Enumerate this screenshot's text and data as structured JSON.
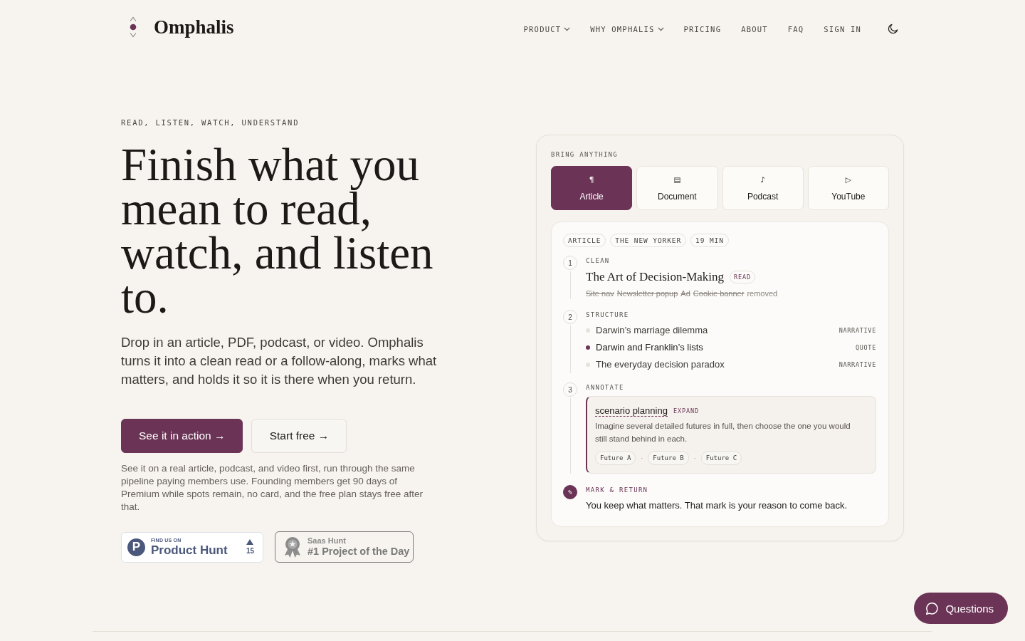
{
  "header": {
    "logo": "Omphalis",
    "nav": [
      {
        "label": "PRODUCT",
        "dropdown": true
      },
      {
        "label": "WHY OMPHALIS",
        "dropdown": true
      },
      {
        "label": "PRICING",
        "dropdown": false
      },
      {
        "label": "ABOUT",
        "dropdown": false
      },
      {
        "label": "FAQ",
        "dropdown": false
      },
      {
        "label": "SIGN IN",
        "dropdown": false
      }
    ]
  },
  "hero": {
    "eyebrow": "READ, LISTEN, WATCH, UNDERSTAND",
    "title": "Finish what you mean to read, watch, and listen to.",
    "lead": "Drop in an article, PDF, podcast, or video. Omphalis turns it into a clean read or a follow-along, marks what matters, and holds it so it is there when you return.",
    "buttons": [
      {
        "label": "See it in action →",
        "kind": "primary"
      },
      {
        "label": "Start free →",
        "kind": "secondary"
      }
    ],
    "note": "See it on a real article, podcast, and video first, run through the same pipeline paying members use. Founding members get 90 days of Premium while spots remain, no card, and the free plan stays free after that.",
    "badges": [
      {
        "kind": "product_hunt",
        "logo": "P",
        "kicker": "FIND US ON",
        "title": "Product Hunt",
        "count": "15"
      },
      {
        "kind": "saas_hunt",
        "kicker": "Saas Hunt",
        "title": "#1 Project of the Day"
      }
    ]
  },
  "demo": {
    "label": "BRING ANYTHING",
    "sources": [
      {
        "icon": "¶",
        "label": "Article",
        "selected": true
      },
      {
        "icon": "▤",
        "label": "Document",
        "selected": false
      },
      {
        "icon": "♪",
        "label": "Podcast",
        "selected": false
      },
      {
        "icon": "▷",
        "label": "YouTube",
        "selected": false
      }
    ],
    "tags": [
      "ARTICLE",
      "THE NEW YORKER",
      "19 MIN"
    ],
    "steps": [
      {
        "kind": "clean",
        "marker": "1",
        "label": "CLEAN",
        "title": "The Art of Decision-Making",
        "badge": "READ",
        "removed": [
          "Site nav",
          "Newsletter popup",
          "Ad",
          "Cookie banner"
        ],
        "suffix": "removed"
      },
      {
        "kind": "structure",
        "marker": "2",
        "label": "STRUCTURE",
        "items": [
          {
            "text": "Darwin’s marriage dilemma",
            "type": "NARRATIVE",
            "selected": false
          },
          {
            "text": "Darwin and Franklin’s lists",
            "type": "QUOTE",
            "selected": true
          },
          {
            "text": "The everyday decision paradox",
            "type": "NARRATIVE",
            "selected": false
          }
        ]
      },
      {
        "kind": "annotate",
        "marker": "3",
        "label": "ANNOTATE",
        "term": "scenario planning",
        "action": "EXPAND",
        "definition": "Imagine several detailed futures in full, then choose the one you would still stand behind in each.",
        "options": [
          {
            "kind": "chip",
            "text": "Future A"
          },
          {
            "kind": "separator",
            "text": "·"
          },
          {
            "kind": "chip",
            "text": "Future B"
          },
          {
            "kind": "separator",
            "text": "·"
          },
          {
            "kind": "chip",
            "text": "Future C"
          }
        ]
      },
      {
        "kind": "mark",
        "marker": "✎",
        "label": "MARK & RETURN",
        "text": "You keep what matters. That mark is your reason to come back."
      }
    ]
  },
  "chat_button": {
    "label": "Questions"
  }
}
